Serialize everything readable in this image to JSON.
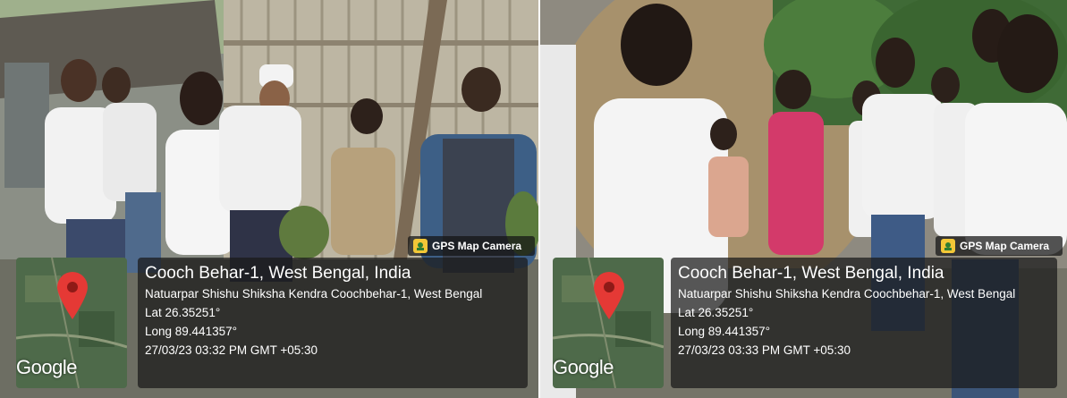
{
  "photos": [
    {
      "badge": "GPS Map Camera",
      "map_label": "Google",
      "map_pin_icon": "location-pin-icon",
      "title": "Cooch Behar-1, West Bengal, India",
      "address": "Natuarpar Shishu Shiksha Kendra Coochbehar-1, West Bengal",
      "lat": "Lat 26.35251°",
      "long": "Long 89.441357°",
      "timestamp": "27/03/23 03:32 PM GMT +05:30"
    },
    {
      "badge": "GPS Map Camera",
      "map_label": "Google",
      "map_pin_icon": "location-pin-icon",
      "title": "Cooch Behar-1, West Bengal, India",
      "address": "Natuarpar Shishu Shiksha Kendra Coochbehar-1, West Bengal",
      "lat": "Lat 26.35251°",
      "long": "Long 89.441357°",
      "timestamp": "27/03/23 03:33 PM GMT +05:30"
    }
  ],
  "colors": {
    "pin": "#e53935",
    "badge_icon": "#f3c737",
    "overlay": "#191919"
  }
}
